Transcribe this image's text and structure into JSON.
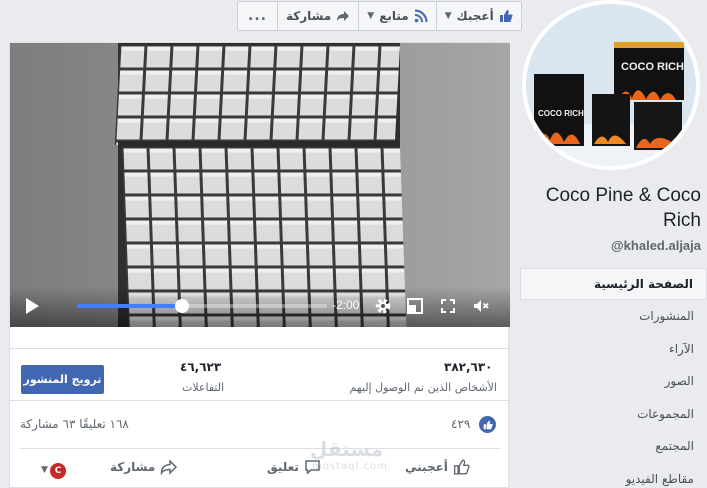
{
  "toolbar": {
    "like_label": "أعجبك",
    "follow_label": "متابع",
    "share_label": "مشاركة",
    "more_label": "..."
  },
  "video": {
    "time_remaining": "-2:00",
    "progress_fraction": 0.42
  },
  "stats": {
    "reach_value": "٣٨٢,٦٣٠",
    "reach_label": "الأشخاص الذين تم الوصول إليهم",
    "engagement_value": "٤٦,٦٢٣",
    "engagement_label": "التفاعلات",
    "promote_label": "ترويج المنشور"
  },
  "reactions": {
    "like_count": "٤٢٩",
    "comments_shares": "١٦٨ تعليقًا  ٦٣ مشاركة"
  },
  "actions": {
    "like": "أعجبني",
    "comment": "تعليق",
    "share": "مشاركة",
    "page_initial": "C"
  },
  "page": {
    "name": "Coco Pine & Coco Rich",
    "handle": "@khaled.aljaja",
    "avatar_text_1": "COCO RICH",
    "avatar_text_2": "COCO RICH"
  },
  "sidebar": {
    "items": [
      {
        "label": "الصفحة الرئيسية",
        "active": true
      },
      {
        "label": "المنشورات"
      },
      {
        "label": "الآراء"
      },
      {
        "label": "الصور"
      },
      {
        "label": "المجموعات"
      },
      {
        "label": "المجتمع"
      },
      {
        "label": "مقاطع الفيديو"
      }
    ]
  },
  "watermark": {
    "text": "مستقل",
    "sub": "mostaql.com"
  },
  "colors": {
    "brand": "#4267b2",
    "progress": "#4080ff",
    "page_dot": "#c62828"
  }
}
